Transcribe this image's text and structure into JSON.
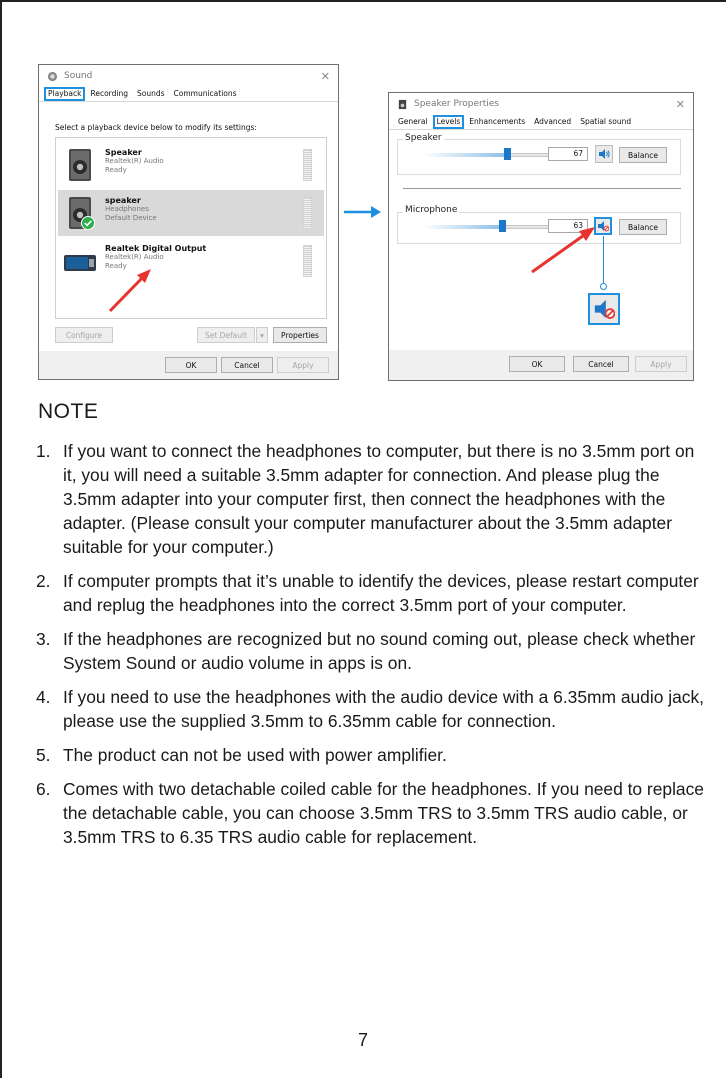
{
  "sound_dialog": {
    "title": "Sound",
    "tabs": [
      "Playback",
      "Recording",
      "Sounds",
      "Communications"
    ],
    "instruction": "Select a playback device below to modify its settings:",
    "devices": [
      {
        "name": "Speaker",
        "line1": "Realtek(R) Audio",
        "line2": "Ready"
      },
      {
        "name": "speaker",
        "line1": "Headphones",
        "line2": "Default Device"
      },
      {
        "name": "Realtek Digital Output",
        "line1": "Realtek(R) Audio",
        "line2": "Ready"
      }
    ],
    "configure_label": "Configure",
    "set_default_label": "Set Default",
    "properties_label": "Properties",
    "ok_label": "OK",
    "cancel_label": "Cancel",
    "apply_label": "Apply"
  },
  "speaker_dialog": {
    "title": "Speaker Properties",
    "tabs": [
      "General",
      "Levels",
      "Enhancements",
      "Advanced",
      "Spatial sound"
    ],
    "speaker": {
      "label": "Speaker",
      "value": "67",
      "level": 0.67,
      "balance_label": "Balance"
    },
    "microphone": {
      "label": "Microphone",
      "value": "63",
      "level": 0.63,
      "balance_label": "Balance"
    },
    "ok_label": "OK",
    "cancel_label": "Cancel",
    "apply_label": "Apply"
  },
  "colors": {
    "accent_blue": "#1f8fe0",
    "arrow_red": "#e8322d",
    "mute_red": "#e53935"
  },
  "note": {
    "title": "NOTE",
    "items": [
      {
        "num": "1.",
        "text": "If you want to connect the headphones to computer, but there is no 3.5mm port on it, you will need a suitable 3.5mm adapter for connection.  And please plug the 3.5mm adapter into your computer first, then connect the headphones with the adapter. (Please consult your computer manufacturer about the 3.5mm adapter suitable for your computer.)"
      },
      {
        "num": "2.",
        "text": "If computer prompts that it’s unable to identify the devices, please restart computer and replug the headphones into the correct 3.5mm port of your computer."
      },
      {
        "num": "3.",
        "text": "If the headphones are recognized but no sound coming out, please check whether System Sound or audio volume in apps is on."
      },
      {
        "num": "4.",
        "text": "If you need to use the headphones with the audio device with a 6.35mm audio jack, please use the supplied 3.5mm to 6.35mm cable for connection."
      },
      {
        "num": "5.",
        "text": "The product can not be used with power amplifier."
      },
      {
        "num": "6.",
        "text": "Comes with two detachable coiled cable for the headphones. If you need to replace the detachable cable, you can choose 3.5mm TRS to 3.5mm TRS audio cable, or 3.5mm TRS to 6.35 TRS audio cable for replacement."
      }
    ]
  },
  "page_number": "7"
}
